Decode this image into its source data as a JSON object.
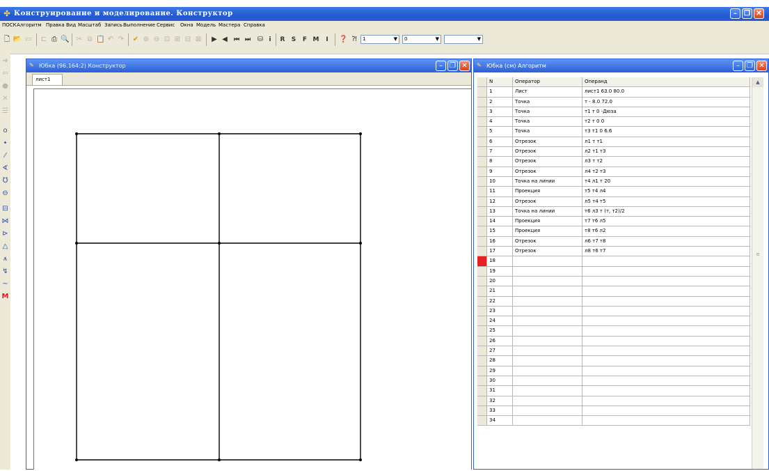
{
  "app": {
    "title": "Конструирование и моделирование. Конструктор"
  },
  "menu": [
    "ПОСК",
    "Алгоритм",
    "Правка",
    "Вид",
    "Масштаб",
    "Запись",
    "Выполнение",
    "Сервис",
    "Окна",
    "Модель",
    "Мастера",
    "Справка"
  ],
  "toolbar": {
    "letters": [
      "R",
      "S",
      "F",
      "M",
      "I"
    ],
    "info_label": "i",
    "combo1_value": "1",
    "combo2_value": "0",
    "combo3_value": ""
  },
  "constructor_window": {
    "title": "Юбка (96.164:2) Конструктор",
    "tab": "лист1"
  },
  "algorithm_window": {
    "title": "Юбка (см) Алгоритм",
    "columns": [
      "N",
      "Оператор",
      "Операнд"
    ],
    "rows": [
      {
        "n": "1",
        "op": "Лист",
        "od": "лист1 63.0 80.0"
      },
      {
        "n": "2",
        "op": "Точка",
        "od": "т - 8.0 72.0"
      },
      {
        "n": "3",
        "op": "Точка",
        "od": "т1 т 0 -Дюза"
      },
      {
        "n": "4",
        "op": "Точка",
        "od": "т2 т 0 0"
      },
      {
        "n": "5",
        "op": "Точка",
        "od": "т3 т1 0 6.6"
      },
      {
        "n": "6",
        "op": "Отрезок",
        "od": "л1 т т1"
      },
      {
        "n": "7",
        "op": "Отрезок",
        "od": "л2 т1 т3"
      },
      {
        "n": "8",
        "op": "Отрезок",
        "od": "л3 т т2"
      },
      {
        "n": "9",
        "op": "Отрезок",
        "od": "л4 т2 т3"
      },
      {
        "n": "10",
        "op": "Точка на линии",
        "od": "т4 л1 т 20"
      },
      {
        "n": "11",
        "op": "Проекция",
        "od": "т5 т4 л4"
      },
      {
        "n": "12",
        "op": "Отрезок",
        "od": "л5 т4 т5"
      },
      {
        "n": "13",
        "op": "Точка на линии",
        "od": "т6 л3 т (т, т2)/2"
      },
      {
        "n": "14",
        "op": "Проекция",
        "od": "т7 т6 л5"
      },
      {
        "n": "15",
        "op": "Проекция",
        "od": "т8 т6 л2"
      },
      {
        "n": "16",
        "op": "Отрезок",
        "od": "л6 т7 т8"
      },
      {
        "n": "17",
        "op": "Отрезок",
        "od": "л8 т6 т7"
      },
      {
        "n": "18",
        "op": "",
        "od": ""
      },
      {
        "n": "19",
        "op": "",
        "od": ""
      },
      {
        "n": "20",
        "op": "",
        "od": ""
      },
      {
        "n": "21",
        "op": "",
        "od": ""
      },
      {
        "n": "22",
        "op": "",
        "od": ""
      },
      {
        "n": "23",
        "op": "",
        "od": ""
      },
      {
        "n": "24",
        "op": "",
        "od": ""
      },
      {
        "n": "25",
        "op": "",
        "od": ""
      },
      {
        "n": "26",
        "op": "",
        "od": ""
      },
      {
        "n": "27",
        "op": "",
        "od": ""
      },
      {
        "n": "28",
        "op": "",
        "od": ""
      },
      {
        "n": "29",
        "op": "",
        "od": ""
      },
      {
        "n": "30",
        "op": "",
        "od": ""
      },
      {
        "n": "31",
        "op": "",
        "od": ""
      },
      {
        "n": "32",
        "op": "",
        "od": ""
      },
      {
        "n": "33",
        "op": "",
        "od": ""
      },
      {
        "n": "34",
        "op": "",
        "od": ""
      }
    ],
    "selected_row_marker": "18"
  },
  "colors": {
    "titlebar": "#2a5ad0",
    "selected_marker": "#e52222",
    "chrome": "#ece9d8"
  },
  "icons": [
    "new-file-icon",
    "open-icon",
    "save-icon",
    "print-icon",
    "preview-icon",
    "cut-icon",
    "copy-icon",
    "paste-icon",
    "undo-icon",
    "redo-icon",
    "check-icon",
    "zoom-icons",
    "play-icon",
    "step-back-icon",
    "first-icon",
    "last-icon",
    "record-icon",
    "help-icon",
    "context-help-icon"
  ]
}
